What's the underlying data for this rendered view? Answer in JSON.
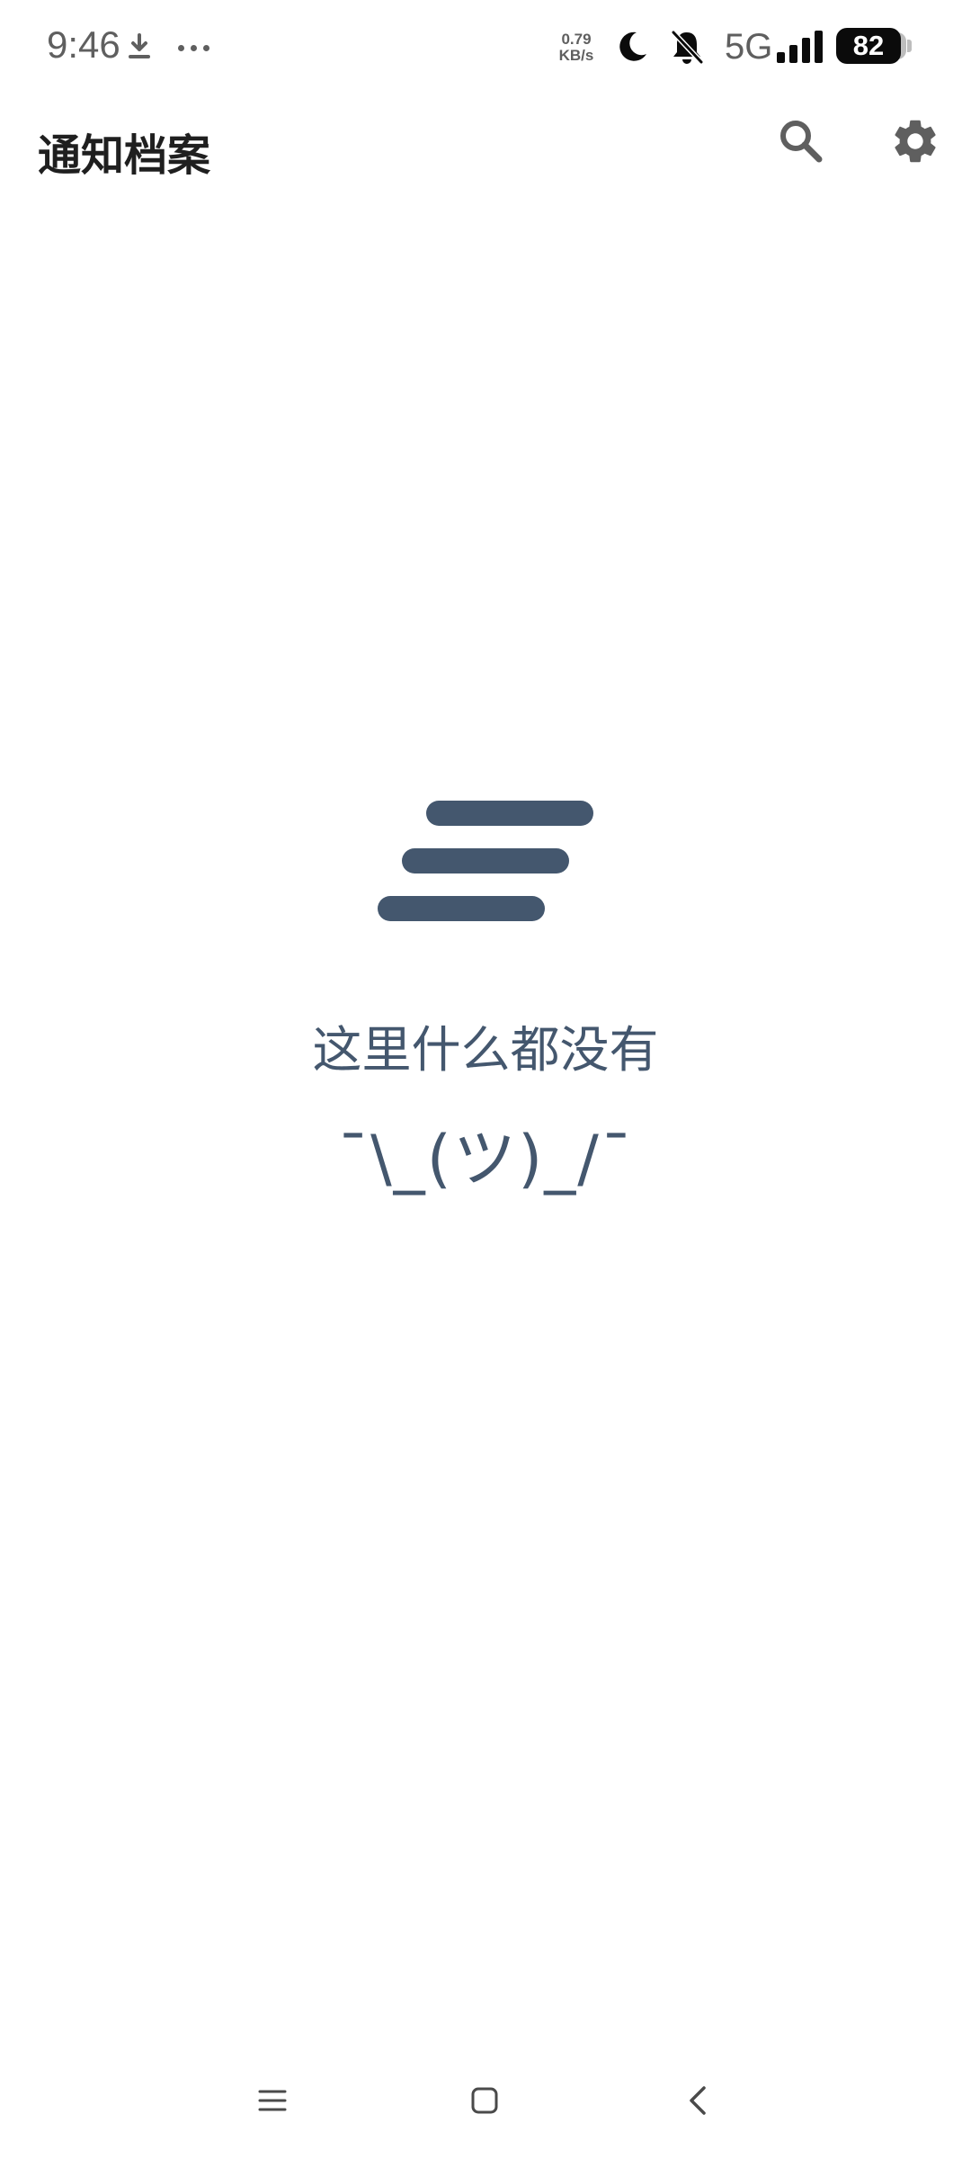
{
  "status_bar": {
    "time": "9:46",
    "net_speed_value": "0.79",
    "net_speed_unit": "KB/s",
    "network": "5G",
    "battery": "82",
    "icons": [
      "download-icon",
      "more-dots-icon",
      "moon-icon",
      "bell-muted-icon",
      "signal-icon",
      "battery-icon"
    ]
  },
  "app_bar": {
    "title": "通知档案",
    "actions": [
      "search-icon",
      "settings-gear-icon"
    ]
  },
  "empty_state": {
    "icon": "list-lines-icon",
    "message": "这里什么都没有",
    "emoticon": "¯\\_(ツ)_/¯"
  },
  "nav_bar": {
    "buttons": [
      "menu-icon",
      "home-icon",
      "back-icon"
    ]
  },
  "colors": {
    "accent": "#44576e",
    "icon_gray": "#5f5f5f",
    "title": "#1f1f1f",
    "background": "#ffffff"
  }
}
